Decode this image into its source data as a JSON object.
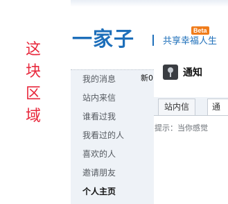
{
  "annotation": {
    "chars": [
      "这",
      "块",
      "区",
      "域"
    ],
    "color": "#e8283c"
  },
  "header": {
    "logo": "一家子",
    "slogan": "共享幸福人生",
    "beta_badge": "Beta",
    "brand_color": "#1e6fba"
  },
  "sidebar": {
    "items": [
      {
        "label": "我的消息",
        "active": false
      },
      {
        "label": "站内来信",
        "active": false
      },
      {
        "label": "谁看过我",
        "active": false
      },
      {
        "label": "我看过的人",
        "active": false
      },
      {
        "label": "喜欢的人",
        "active": false
      },
      {
        "label": "邀请朋友",
        "active": false
      },
      {
        "label": "个人主页",
        "active": true
      }
    ],
    "new_count": "新0"
  },
  "notice": {
    "icon": "speaker-icon",
    "title": "通知"
  },
  "tabs": [
    {
      "label": "站内信"
    },
    {
      "label": "通"
    }
  ],
  "hint": "提示：当你感觉"
}
